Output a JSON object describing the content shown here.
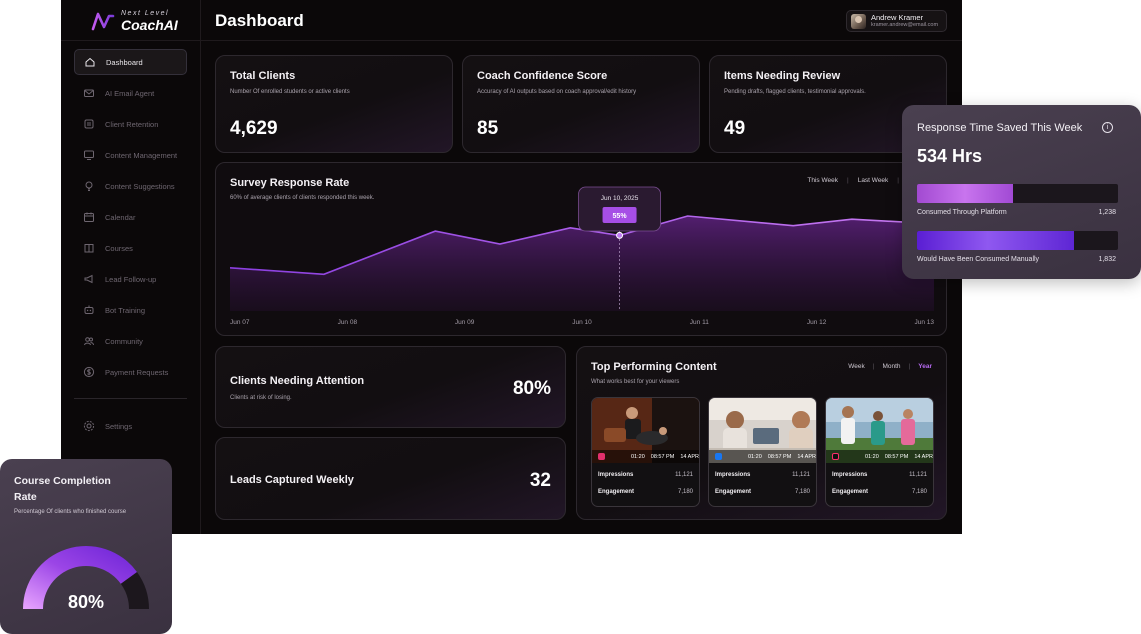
{
  "app": {
    "logo_small": "Next Level",
    "logo_main": "CoachAI"
  },
  "header": {
    "title": "Dashboard",
    "user": {
      "name": "Andrew Kramer",
      "email": "kramer.andrew@email.com"
    }
  },
  "sidebar": {
    "items": [
      {
        "label": "Dashboard",
        "icon": "home-icon",
        "active": true
      },
      {
        "label": "AI Email Agent",
        "icon": "mail-icon"
      },
      {
        "label": "Client Retention",
        "icon": "retention-icon"
      },
      {
        "label": "Content Management",
        "icon": "content-icon"
      },
      {
        "label": "Content Suggestions",
        "icon": "lightbulb-icon"
      },
      {
        "label": "Calendar",
        "icon": "calendar-icon"
      },
      {
        "label": "Courses",
        "icon": "book-icon"
      },
      {
        "label": "Lead Follow-up",
        "icon": "megaphone-icon"
      },
      {
        "label": "Bot Training",
        "icon": "bot-icon"
      },
      {
        "label": "Community",
        "icon": "community-icon"
      },
      {
        "label": "Payment Requests",
        "icon": "dollar-icon"
      }
    ],
    "settings": {
      "label": "Settings",
      "icon": "gear-icon"
    }
  },
  "stats": [
    {
      "title": "Total Clients",
      "subtitle": "Number Of enrolled students or active clients",
      "value": "4,629"
    },
    {
      "title": "Coach Confidence Score",
      "subtitle": "Accuracy of AI outputs based on coach approval/edit history",
      "value": "85"
    },
    {
      "title": "Items Needing Review",
      "subtitle": "Pending drafts, flagged clients, testimonial approvals.",
      "value": "49"
    }
  ],
  "survey": {
    "title": "Survey Response Rate",
    "subtitle": "60% of average clients of clients responded this week.",
    "tabs": [
      "This Week",
      "Last Week"
    ],
    "tooltip": {
      "date": "Jun 10, 2025",
      "value": "55%"
    }
  },
  "chart_data": {
    "type": "area",
    "title": "Survey Response Rate",
    "x": [
      "Jun 07",
      "Jun 08",
      "Jun 09",
      "Jun 10",
      "Jun 11",
      "Jun 12",
      "Jun 13"
    ],
    "points": [
      {
        "x": 0.0,
        "y": 40
      },
      {
        "x": 0.8,
        "y": 34
      },
      {
        "x": 1.75,
        "y": 74
      },
      {
        "x": 2.3,
        "y": 62
      },
      {
        "x": 2.9,
        "y": 77
      },
      {
        "x": 3.32,
        "y": 70
      },
      {
        "x": 3.9,
        "y": 88
      },
      {
        "x": 4.8,
        "y": 79
      },
      {
        "x": 5.3,
        "y": 85
      },
      {
        "x": 5.8,
        "y": 82
      },
      {
        "x": 6.0,
        "y": 96
      }
    ],
    "ylim": [
      0,
      100
    ],
    "highlight": {
      "x": 3.32,
      "label": "55%",
      "date": "Jun 10, 2025"
    },
    "grid": false
  },
  "attention": {
    "title": "Clients Needing Attention",
    "subtitle": "Clients at risk of losing.",
    "value": "80%"
  },
  "leads": {
    "title": "Leads Captured Weekly",
    "value": "32"
  },
  "top_content": {
    "title": "Top Performing Content",
    "subtitle": "What works best for your viewers",
    "tabs": [
      "Week",
      "Month",
      "Year"
    ],
    "active_tab": "Year",
    "videos": [
      {
        "platform": "instagram-icon",
        "platform_color": "#e1306c",
        "duration": "01:20",
        "time": "08:57 PM",
        "date": "14 APR",
        "impressions_label": "Impressions",
        "impressions": "11,121",
        "engagement_label": "Engagement",
        "engagement": "7,180"
      },
      {
        "platform": "facebook-icon",
        "platform_color": "#1877f2",
        "duration": "01:20",
        "time": "08:57 PM",
        "date": "14 APR",
        "impressions_label": "Impressions",
        "impressions": "11,121",
        "engagement_label": "Engagement",
        "engagement": "7,180"
      },
      {
        "platform": "tiktok-icon",
        "platform_color": "#111111",
        "duration": "01:20",
        "time": "08:57 PM",
        "date": "14 APR",
        "impressions_label": "Impressions",
        "impressions": "11,121",
        "engagement_label": "Engagement",
        "engagement": "7,180"
      }
    ]
  },
  "response_time": {
    "title": "Response Time Saved This Week",
    "value": "534 Hrs",
    "bars": [
      {
        "label": "Consumed Through Platform",
        "value": "1,238",
        "fill_fraction": 0.48
      },
      {
        "label": "Would Have Been Consumed Manually",
        "value": "1,832",
        "fill_fraction": 0.78
      }
    ]
  },
  "course_completion": {
    "title": "Course Completion Rate",
    "subtitle": "Percentage Of clients who finished course",
    "value": "80%",
    "fraction": 0.8
  },
  "colors": {
    "accent": "#a855f7",
    "accent_bright": "#c074f0",
    "background": "#0b0809"
  }
}
